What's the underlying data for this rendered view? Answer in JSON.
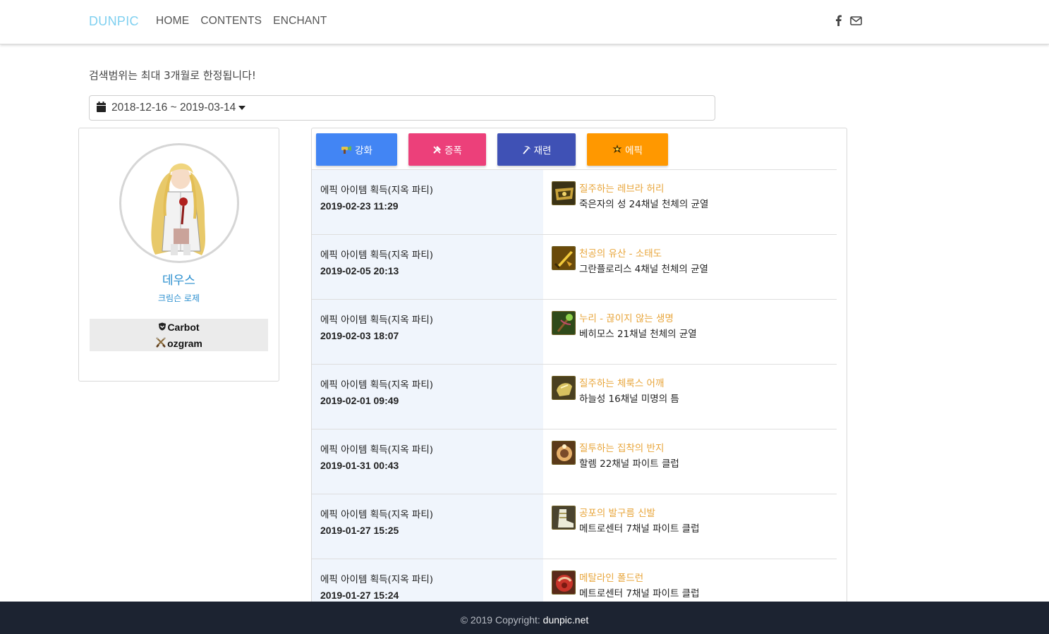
{
  "nav": {
    "brand": "DUNPIC",
    "links": [
      "HOME",
      "CONTENTS",
      "ENCHANT"
    ],
    "social_icons": [
      "facebook-icon",
      "envelope-icon"
    ]
  },
  "search": {
    "notice": "검색범위는 최대 3개월로 한정됩니다!",
    "date_range": "2018-12-16 ~ 2019-03-14"
  },
  "profile": {
    "name": "데우스",
    "class": "크림슨 로제",
    "adventure": "Carbot",
    "guild": "ozgram"
  },
  "filters": [
    {
      "label": "강화",
      "icon": "enchant-hammer-icon",
      "color": "#4285f4"
    },
    {
      "label": "증폭",
      "icon": "amplify-tools-icon",
      "color": "#ec407a"
    },
    {
      "label": "재련",
      "icon": "pickaxe-icon",
      "color": "#3f51b5"
    },
    {
      "label": "에픽",
      "icon": "epic-star-icon",
      "color": "#ff9800"
    }
  ],
  "entries": [
    {
      "event": "에픽 아이템 획득(지옥 파티)",
      "datetime": "2019-02-23 11:29",
      "item": "질주하는 레브라 허리",
      "location": "죽은자의 성 24채널 천체의 균열",
      "icon": "waist-armor-icon"
    },
    {
      "event": "에픽 아이템 획득(지옥 파티)",
      "datetime": "2019-02-05 20:13",
      "item": "천공의 유산 - 소태도",
      "location": "그란플로리스 4채널 천체의 균열",
      "icon": "sword-icon"
    },
    {
      "event": "에픽 아이템 획득(지옥 파티)",
      "datetime": "2019-02-03 18:07",
      "item": "누리 - 끊이지 않는 생명",
      "location": "베히모스 21채널 천체의 균열",
      "icon": "staff-icon"
    },
    {
      "event": "에픽 아이템 획득(지옥 파티)",
      "datetime": "2019-02-01 09:49",
      "item": "질주하는 체룩스 어깨",
      "location": "하늘성 16채널 미명의 틈",
      "icon": "shoulder-armor-icon"
    },
    {
      "event": "에픽 아이템 획득(지옥 파티)",
      "datetime": "2019-01-31 00:43",
      "item": "질투하는 집착의 반지",
      "location": "할렘 22채널 파이트 클럽",
      "icon": "ring-icon"
    },
    {
      "event": "에픽 아이템 획득(지옥 파티)",
      "datetime": "2019-01-27 15:25",
      "item": "공포의 발구름 신발",
      "location": "메트로센터 7채널 파이트 클럽",
      "icon": "boots-icon"
    },
    {
      "event": "에픽 아이템 획득(지옥 파티)",
      "datetime": "2019-01-27 15:24",
      "item": "메탈라인 폴드런",
      "location": "메트로센터 7채널 파이트 클럽",
      "icon": "pauldron-icon"
    }
  ],
  "footer": {
    "copyright": "© 2019 Copyright: ",
    "site": "dunpic.net"
  }
}
